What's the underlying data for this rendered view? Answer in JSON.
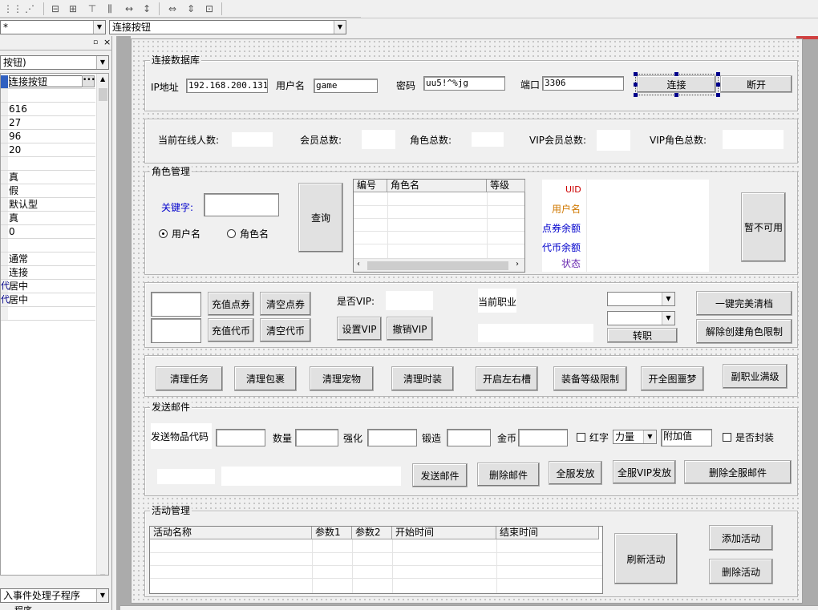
{
  "toolbar": {
    "icons": [
      "grid-align-icon",
      "tab-order-icon",
      "center-h-icon",
      "center-v-icon",
      "align-top-icon",
      "distribute-h-icon",
      "space-h-icon",
      "space-v-icon",
      "same-width-icon",
      "same-height-icon",
      "same-size-icon"
    ]
  },
  "object_combo": {
    "value": "*"
  },
  "control_combo": {
    "value": "连接按钮"
  },
  "props": {
    "combo_value": "按钮)",
    "rows": [
      "连接按钮",
      "",
      "616",
      "27",
      "96",
      "20",
      "",
      "真",
      "假",
      "默认型",
      "真",
      "0",
      "",
      "通常",
      "连接",
      "居中",
      "居中",
      ""
    ],
    "left_marks": [
      "",
      "",
      "",
      "",
      "",
      "",
      "",
      "",
      "",
      "",
      "",
      "",
      "",
      "",
      "",
      "代",
      "代",
      ""
    ],
    "event_combo": "入事件处理子程序",
    "status_text": "程序"
  },
  "db": {
    "title": "连接数据库",
    "ip_label": "IP地址",
    "ip_value": "192.168.200.131",
    "user_label": "用户名",
    "user_value": "game",
    "pwd_label": "密码",
    "pwd_value": "uu5!^%jg",
    "port_label": "端口",
    "port_value": "3306",
    "connect_btn": "连接",
    "disconnect_btn": "断开"
  },
  "stats": {
    "online_label": "当前在线人数:",
    "members_label": "会员总数:",
    "roles_label": "角色总数:",
    "vip_members_label": "VIP会员总数:",
    "vip_roles_label": "VIP角色总数:"
  },
  "roles": {
    "title": "角色管理",
    "keyword_label": "关键字:",
    "query_btn": "查询",
    "radio_user": "用户名",
    "radio_role": "角色名",
    "columns": [
      "编号",
      "角色名",
      "等级"
    ],
    "info_uid": "UID",
    "info_user": "用户名",
    "info_points": "点券余额",
    "info_coins": "代币余额",
    "info_status": "状态",
    "unavailable_btn": "暂不可用",
    "colors": {
      "uid": "#cc0000",
      "user": "#d07800",
      "blue": "#0000cc",
      "status": "#6a2ab0"
    }
  },
  "recharge": {
    "charge_points": "充值点券",
    "clear_points": "清空点券",
    "charge_coins": "充值代币",
    "clear_coins": "清空代币",
    "is_vip_label": "是否VIP:",
    "set_vip": "设置VIP",
    "cancel_vip": "撤销VIP",
    "job_label": "当前职业",
    "change_job": "转职",
    "perfect_clear": "一键完美清档",
    "remove_limit": "解除创建角色限制"
  },
  "actions": [
    "清理任务",
    "清理包裹",
    "清理宠物",
    "清理时装",
    "开启左右槽",
    "装备等级限制",
    "开全图噩梦",
    "副职业满级"
  ],
  "mail": {
    "title": "发送邮件",
    "item_code_label": "发送物品代码",
    "qty_label": "数量",
    "enhance_label": "强化",
    "forge_label": "锻造",
    "gold_label": "金币",
    "red_label": "红字",
    "attr_value": "力量",
    "extra_label": "附加值",
    "seal_label": "是否封装",
    "send_btn": "发送邮件",
    "delete_btn": "删除邮件",
    "server_send_btn": "全服发放",
    "server_vip_btn": "全服VIP发放",
    "delete_all_btn": "删除全服邮件"
  },
  "activity": {
    "title": "活动管理",
    "columns": [
      "活动名称",
      "参数1",
      "参数2",
      "开始时间",
      "结束时间"
    ],
    "refresh_btn": "刷新活动",
    "add_btn": "添加活动",
    "delete_btn": "删除活动"
  }
}
